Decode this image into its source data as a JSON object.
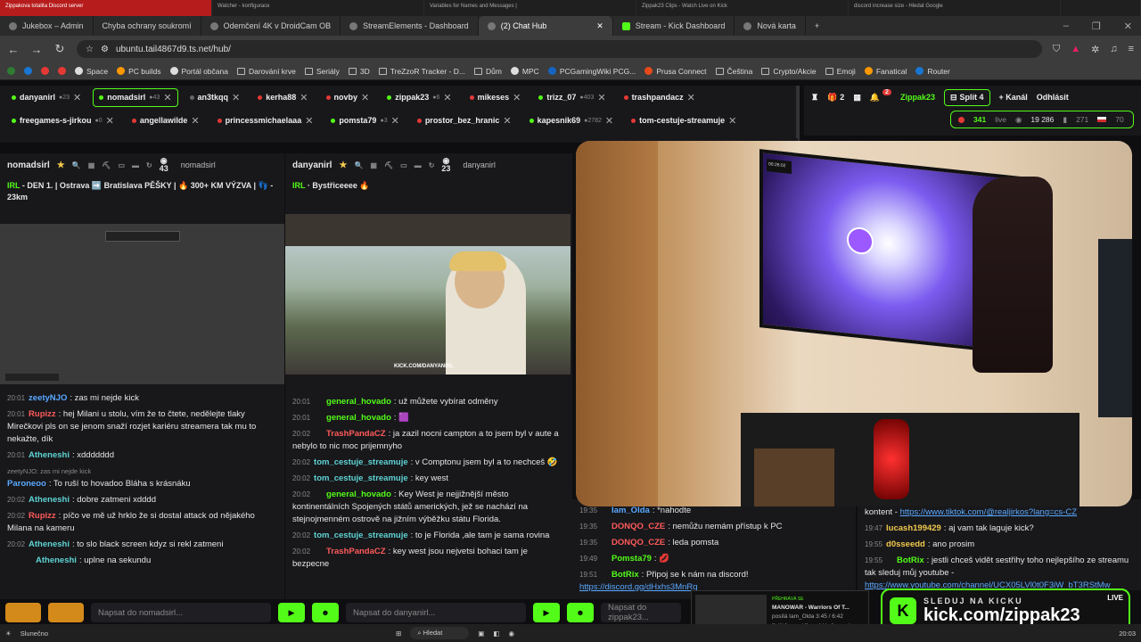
{
  "browser": {
    "top_tabs": [
      "Zippakova totalita Discord server",
      "Watcher - konfigurace",
      "Variables for Names and Messages |",
      "Zippak23 Clips - Watch Live on Kick",
      "discord increase size - Hledat Google"
    ],
    "tabs": [
      {
        "label": "Jukebox – Admin"
      },
      {
        "label": "Chyba ochrany soukromí"
      },
      {
        "label": "Odemčení 4K v DroidCam OB"
      },
      {
        "label": "StreamElements - Dashboard"
      },
      {
        "label": "(2) Chat Hub",
        "active": true
      },
      {
        "label": "Stream - Kick Dashboard"
      },
      {
        "label": "Nová karta"
      }
    ],
    "new_tab": "+",
    "url": "ubuntu.tail4867d9.ts.net/hub/",
    "bookmarks": [
      "Space",
      "PC builds",
      "Portál občana",
      "Darování krve",
      "Seriály",
      "3D",
      "TreZzoR Tracker - D...",
      "Dům",
      "MPC",
      "PCGamingWiki PCG...",
      "Prusa Connect",
      "Čeština",
      "Crypto/Akcie",
      "Emoji",
      "Fanatical",
      "Router"
    ]
  },
  "channels": {
    "row1": [
      {
        "name": "danyanirl",
        "viewers": "23"
      },
      {
        "name": "nomadsirl",
        "viewers": "43",
        "selected": true
      },
      {
        "name": "an3tkqq",
        "viewers": ""
      },
      {
        "name": "kerha88",
        "viewers": ""
      },
      {
        "name": "novby",
        "viewers": ""
      },
      {
        "name": "zippak23",
        "viewers": "6"
      },
      {
        "name": "mikeses",
        "viewers": ""
      },
      {
        "name": "trizz_07",
        "viewers": "403"
      },
      {
        "name": "trashpandacz",
        "viewers": ""
      }
    ],
    "row2": [
      {
        "name": "freegames-s-jirkou",
        "viewers": "0"
      },
      {
        "name": "angellawilde",
        "viewers": ""
      },
      {
        "name": "princessmichaelaaa",
        "viewers": ""
      },
      {
        "name": "pomsta79",
        "viewers": "3"
      },
      {
        "name": "prostor_bez_hranic",
        "viewers": ""
      },
      {
        "name": "kapesnik69",
        "viewers": "2782"
      },
      {
        "name": "tom-cestuje-streamuje",
        "viewers": ""
      }
    ]
  },
  "right_controls": {
    "gift_count": "2",
    "notif_badge": "2",
    "user": "Zippak23",
    "split": "Split 4",
    "add_channel": "+ Kanál",
    "logout": "Odhlásit",
    "live_viewers": "341",
    "live_label": "live",
    "total_viewers": "19 286",
    "cz_count": "271",
    "other_count": "70"
  },
  "pane1": {
    "name": "nomadsirl",
    "viewers": "43",
    "pinned": "nomadsirl",
    "title_tag": "IRL",
    "title": " - DEN 1. | Ostrava ➡️ Bratislava PĚŠKY | 🔥 300+ KM VÝZVA | 👣 - 23km",
    "messages": [
      {
        "ts": "20:01",
        "user": "zeetyNJO",
        "color": "#5aa9ff",
        "text": "zas mi nejde kick"
      },
      {
        "ts": "20:01",
        "user": "Rupizz",
        "color": "#ff5a5a",
        "text": "hej Milani u stolu, vím že to čtete, nedělejte tlaky Mirečkovi pls on se jenom snaží rozjet kariéru streamera tak mu to nekažte, dík"
      },
      {
        "ts": "20:01",
        "user": "Atheneshi",
        "color": "#5fd3d3",
        "text": "xddddddd"
      },
      {
        "ts": "",
        "user": "Paroneoo",
        "color": "#5aa9ff",
        "text": "To ruší to hovadoo Bláha s krásnáku",
        "reply": "zeetyNJO: zas mi nejde kick"
      },
      {
        "ts": "20:02",
        "user": "Atheneshi",
        "color": "#5fd3d3",
        "text": "dobre zatmeni xdddd"
      },
      {
        "ts": "20:02",
        "user": "Rupizz",
        "color": "#ff5a5a",
        "text": "píčo ve mě už hrklo že si dostal attack od nějakého Milana na kameru"
      },
      {
        "ts": "20:02",
        "user": "Atheneshi",
        "color": "#5fd3d3",
        "text": "to slo black screen kdyz si rekl zatmeni"
      },
      {
        "ts": "",
        "user": "Atheneshi",
        "color": "#5fd3d3",
        "text": "uplne na sekundu"
      }
    ],
    "input_placeholder": "Napsat do nomadsirl..."
  },
  "pane2": {
    "name": "danyanirl",
    "viewers": "23",
    "pinned": "danyanirl",
    "title_tag": "IRL",
    "title": " · Bystřiceeee 🔥",
    "video_caption": "KICK.COM/DANYANIRL",
    "messages": [
      {
        "ts": "20:01",
        "user": "general_hovado",
        "color": "#53fc18",
        "text": "už můžete vybírat odměny"
      },
      {
        "ts": "20:01",
        "user": "general_hovado",
        "color": "#53fc18",
        "text": "🟪"
      },
      {
        "ts": "20:02",
        "user": "TrashPandaCZ",
        "color": "#ff5a5a",
        "text": "ja zazil nocni campton a to jsem byl v aute a nebylo to nic moc prijemnyho"
      },
      {
        "ts": "20:02",
        "user": "tom_cestuje_streamuje",
        "color": "#5fd3d3",
        "text": "v Comptonu jsem byl a to nechceš 🤣"
      },
      {
        "ts": "20:02",
        "user": "tom_cestuje_streamuje",
        "color": "#5fd3d3",
        "text": "key west"
      },
      {
        "ts": "20:02",
        "user": "general_hovado",
        "color": "#53fc18",
        "text": "Key West je nejjižnější město kontinentálních Spojených států amerických, jež se nachází na stejnojmenném ostrově na jižním výběžku státu Florida."
      },
      {
        "ts": "20:02",
        "user": "tom_cestuje_streamuje",
        "color": "#5fd3d3",
        "text": "to je Florida ,ale tam je sama rovina"
      },
      {
        "ts": "20:02",
        "user": "TrashPandaCZ",
        "color": "#ff5a5a",
        "text": "key west jsou nejvetsi bohaci tam je bezpecne"
      }
    ],
    "input_placeholder": "Napsat do danyanirl..."
  },
  "pane3": {
    "messages": [
      {
        "ts": "19:35",
        "user": "Iam_Olda",
        "color": "#5aa9ff",
        "text": "*nahodte"
      },
      {
        "ts": "19:35",
        "user": "DONQO_CZE",
        "color": "#ff5a5a",
        "text": "nemůžu nemám přístup k PC"
      },
      {
        "ts": "19:35",
        "user": "DONQO_CZE",
        "color": "#ff5a5a",
        "text": "leda pomsta"
      },
      {
        "ts": "19:49",
        "user": "Pomsta79",
        "color": "#53fc18",
        "text": "💋"
      },
      {
        "ts": "19:51",
        "user": "BotRix",
        "color": "#53fc18",
        "text": "Připoj se k nám na discord! ",
        "link": "https://discord.gg/dHxhs3MnRq"
      }
    ],
    "input_placeholder": "Napsat do zippak23..."
  },
  "pane4": {
    "messages": [
      {
        "ts": "",
        "user": "",
        "color": "#fff",
        "text": "kontent - ",
        "link": "https://www.tiktok.com/@realjirkos?lang=cs-CZ"
      },
      {
        "ts": "19:47",
        "user": "lucash199429",
        "color": "#f2c94c",
        "text": "aj vam tak laguje kick?"
      },
      {
        "ts": "19:55",
        "user": "d0sseedd",
        "color": "#f2c94c",
        "text": "ano prosim"
      },
      {
        "ts": "19:55",
        "user": "BotRix",
        "color": "#53fc18",
        "text": "jestli chceš vidět sestřihy toho nejlepšího ze streamu tak sleduj můj youtube - ",
        "link": "https://www.youtube.com/channel/UCX05LVl0t0F3iW_bT3RStMw"
      }
    ]
  },
  "overlay": {
    "timer": "00:26:02",
    "kick_top": "SLEDUJ NA KICKU",
    "kick_url": "kick.com/zippak23",
    "live": "LIVE",
    "music_label": "PŘEHRÁVÁ SE",
    "music_title": "MANOWAR - Warriors Of T...",
    "music_by": "posílá Iam_Olda",
    "music_time": "3:45 / 6:42",
    "music_next": "Další Avenged Sevenfold - Avenged..."
  },
  "taskbar": {
    "weather": "Slunečno",
    "search": "Hledat",
    "clock": "20:03"
  }
}
